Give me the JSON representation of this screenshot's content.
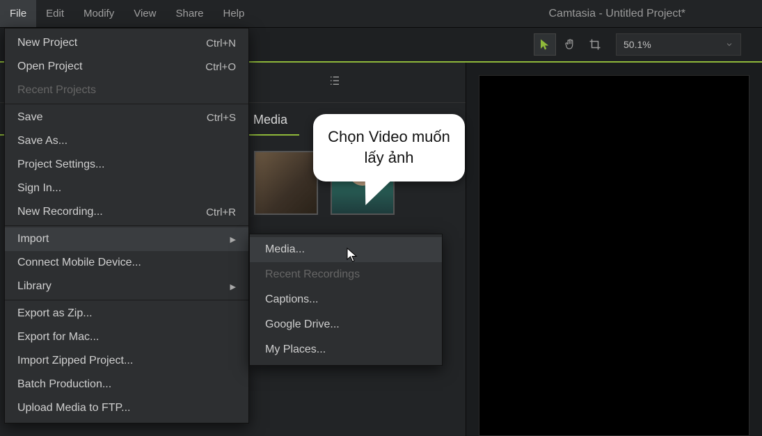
{
  "menubar": {
    "items": [
      "File",
      "Edit",
      "Modify",
      "View",
      "Share",
      "Help"
    ],
    "active": "File"
  },
  "window_title": "Camtasia - Untitled Project*",
  "toolbar": {
    "zoom": "50.1%"
  },
  "media_panel": {
    "label": "Media"
  },
  "file_menu": [
    {
      "label": "New Project",
      "shortcut": "Ctrl+N"
    },
    {
      "label": "Open Project",
      "shortcut": "Ctrl+O"
    },
    {
      "label": "Recent Projects",
      "disabled": true,
      "sep": true
    },
    {
      "label": "Save",
      "shortcut": "Ctrl+S"
    },
    {
      "label": "Save As..."
    },
    {
      "label": "Project Settings..."
    },
    {
      "label": "Sign In..."
    },
    {
      "label": "New Recording...",
      "shortcut": "Ctrl+R",
      "sep": true
    },
    {
      "label": "Import",
      "submenu": true,
      "hl": true
    },
    {
      "label": "Connect Mobile Device..."
    },
    {
      "label": "Library",
      "submenu": true,
      "sep": true
    },
    {
      "label": "Export as Zip..."
    },
    {
      "label": "Export for Mac..."
    },
    {
      "label": "Import Zipped Project..."
    },
    {
      "label": "Batch Production..."
    },
    {
      "label": "Upload Media to FTP..."
    }
  ],
  "import_submenu": [
    {
      "label": "Media...",
      "hl": true
    },
    {
      "label": "Recent Recordings",
      "disabled": true
    },
    {
      "label": "Captions..."
    },
    {
      "label": "Google Drive..."
    },
    {
      "label": "My Places..."
    }
  ],
  "callout_text": "Chọn Video muốn lấy ảnh"
}
